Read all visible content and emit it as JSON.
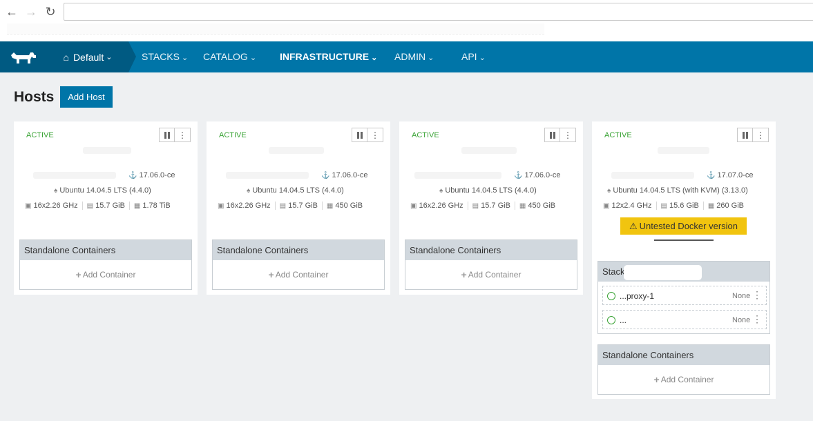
{
  "browser": {
    "back_icon": "arrow-left",
    "forward_icon": "arrow-right",
    "reload_icon": "refresh"
  },
  "header": {
    "env_label": "Default",
    "nav": [
      {
        "label": "STACKS"
      },
      {
        "label": "CATALOG"
      },
      {
        "label": "INFRASTRUCTURE"
      },
      {
        "label": "ADMIN"
      },
      {
        "label": "API"
      }
    ],
    "colors": {
      "bar": "#0075a8",
      "env_bg": "#005a82"
    }
  },
  "page": {
    "title": "Hosts",
    "add_host_label": "Add Host"
  },
  "hosts": [
    {
      "state": "ACTIVE",
      "docker": "17.06.0-ce",
      "os": "Ubuntu 14.04.5 LTS (4.4.0)",
      "cpu": "16x2.26 GHz",
      "memory": "15.7 GiB",
      "storage": "1.78 TiB",
      "standalone_label": "Standalone Containers",
      "add_container_label": "Add Container"
    },
    {
      "state": "ACTIVE",
      "docker": "17.06.0-ce",
      "os": "Ubuntu 14.04.5 LTS (4.4.0)",
      "cpu": "16x2.26 GHz",
      "memory": "15.7 GiB",
      "storage": "450 GiB",
      "standalone_label": "Standalone Containers",
      "add_container_label": "Add Container"
    },
    {
      "state": "ACTIVE",
      "docker": "17.06.0-ce",
      "os": "Ubuntu 14.04.5 LTS (4.4.0)",
      "cpu": "16x2.26 GHz",
      "memory": "15.7 GiB",
      "storage": "450 GiB",
      "standalone_label": "Standalone Containers",
      "add_container_label": "Add Container"
    },
    {
      "state": "ACTIVE",
      "docker": "17.07.0-ce",
      "os": "Ubuntu 14.04.5 LTS (with KVM) (3.13.0)",
      "cpu": "12x2.4 GHz",
      "memory": "15.6 GiB",
      "storage": "260 GiB",
      "warning": "Untested Docker version",
      "stack_label": "Stack",
      "services": [
        {
          "name": "...proxy-1",
          "scale": "None"
        },
        {
          "name": "...",
          "scale": "None"
        }
      ],
      "standalone_label": "Standalone Containers",
      "add_container_label": "Add Container"
    }
  ]
}
